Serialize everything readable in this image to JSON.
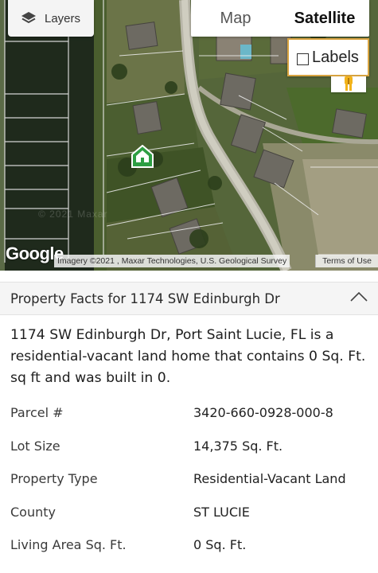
{
  "map": {
    "layers_label": "Layers",
    "map_type": {
      "options": [
        "Map",
        "Satellite"
      ],
      "selected": "Satellite"
    },
    "labels_checkbox": {
      "label": "Labels",
      "checked": false
    },
    "google_logo": "Google",
    "watermark": "© 2021 Maxar",
    "attribution": "Imagery ©2021 , Maxar Technologies, U.S. Geological Survey",
    "terms_link": "Terms of Use",
    "marker_color": "#2e9e43"
  },
  "facts": {
    "header_title": "Property Facts for 1174 SW Edinburgh Dr",
    "description": "1174 SW Edinburgh Dr, Port Saint Lucie, FL is a residential-vacant land home that contains 0 Sq. Ft. sq ft and was built in 0.",
    "rows": [
      {
        "label": "Parcel #",
        "value": "3420-660-0928-000-8"
      },
      {
        "label": "Lot Size",
        "value": "14,375 Sq. Ft."
      },
      {
        "label": "Property Type",
        "value": "Residential-Vacant Land"
      },
      {
        "label": "County",
        "value": "ST LUCIE"
      },
      {
        "label": "Living Area Sq. Ft.",
        "value": "0 Sq. Ft."
      }
    ]
  },
  "colors": {
    "panel_header_bg": "#f5f5f5",
    "labels_border": "#d9a441",
    "marker": "#2e9e43"
  }
}
